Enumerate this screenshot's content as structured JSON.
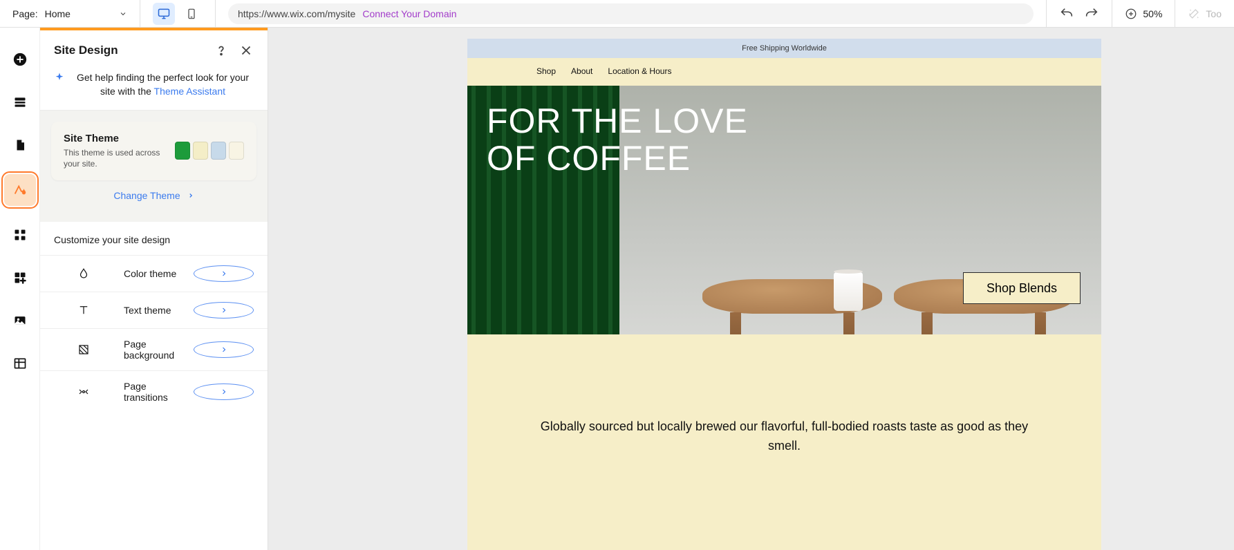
{
  "topbar": {
    "page_label": "Page:",
    "page_name": "Home",
    "url": "https://www.wix.com/mysite",
    "connect_domain": "Connect Your Domain",
    "zoom": "50%",
    "tools": "Too"
  },
  "panel": {
    "title": "Site Design",
    "helper_pre": "Get help finding the perfect look for your site with the ",
    "helper_link": "Theme Assistant",
    "theme_card": {
      "title": "Site Theme",
      "desc": "This theme is used across your site."
    },
    "swatches": [
      "#1d9b3b",
      "#f4eec7",
      "#c7daea",
      "#f8f4e4"
    ],
    "change_theme": "Change Theme",
    "customize_title": "Customize your site design",
    "rows": [
      {
        "label": "Color theme",
        "icon": "droplet"
      },
      {
        "label": "Text theme",
        "icon": "text"
      },
      {
        "label": "Page background",
        "icon": "background"
      },
      {
        "label": "Page transitions",
        "icon": "transitions"
      }
    ]
  },
  "site": {
    "announce": "Free Shipping Worldwide",
    "nav": [
      "Shop",
      "About",
      "Location & Hours"
    ],
    "hero_line1": "FOR THE LOVE",
    "hero_line2": "OF COFFEE",
    "cta": "Shop Blends",
    "tagline": "Globally sourced but locally brewed our flavorful, full-bodied roasts taste as good as they smell."
  }
}
